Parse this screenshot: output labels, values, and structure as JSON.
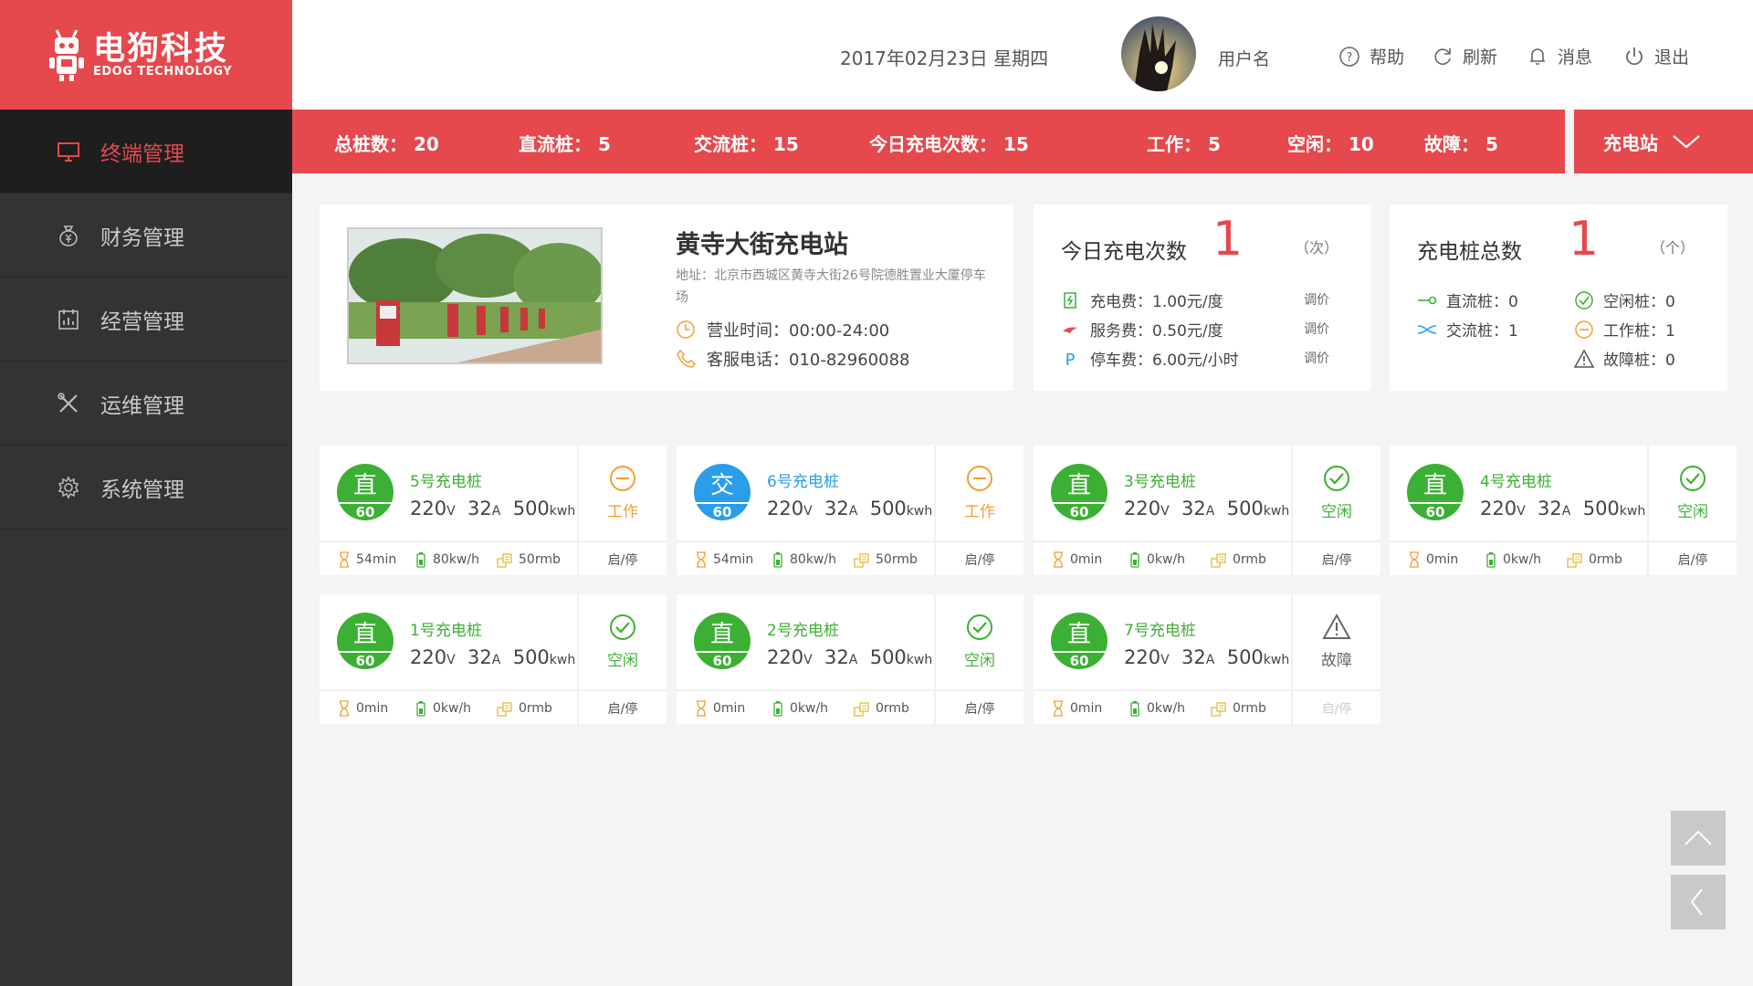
{
  "brand": {
    "name_cn": "电狗科技",
    "name_en": "EDOG TECHNOLOGY",
    "color": "#e5484d"
  },
  "sidebar": {
    "items": [
      {
        "label": "终端管理",
        "icon": "monitor-icon",
        "active": true
      },
      {
        "label": "财务管理",
        "icon": "money-bag-icon",
        "active": false
      },
      {
        "label": "经营管理",
        "icon": "calendar-chart-icon",
        "active": false
      },
      {
        "label": "运维管理",
        "icon": "tools-icon",
        "active": false
      },
      {
        "label": "系统管理",
        "icon": "gear-icon",
        "active": false
      }
    ]
  },
  "header": {
    "date": "2017年02月23日  星期四",
    "username": "用户名",
    "help": "帮助",
    "refresh": "刷新",
    "messages": "消息",
    "logout": "退出"
  },
  "stats": {
    "total_label": "总桩数：",
    "total": "20",
    "dc_label": "直流桩：",
    "dc": "5",
    "ac_label": "交流桩：",
    "ac": "15",
    "today_label": "今日充电次数：",
    "today": "15",
    "working_label": "工作：",
    "working": "5",
    "idle_label": "空闲：",
    "idle": "10",
    "fault_label": "故障：",
    "fault": "5",
    "station_select": "充电站"
  },
  "station": {
    "name": "黄寺大街充电站",
    "address": "地址：北京市西城区黄寺大街26号院德胜置业大厦停车场",
    "hours": "营业时间：00:00-24:00",
    "phone": "客服电话：010-82960088"
  },
  "today_panel": {
    "title": "今日充电次数",
    "value": "1",
    "unit": "（次）",
    "fees": [
      {
        "label": "充电费：1.00元/度",
        "adjust": "调价",
        "icon": "charger-icon"
      },
      {
        "label": "服务费：0.50元/度",
        "adjust": "调价",
        "icon": "service-icon"
      },
      {
        "label": "停车费：6.00元/小时",
        "adjust": "调价",
        "icon": "parking-icon"
      }
    ]
  },
  "pile_panel": {
    "title": "充电桩总数",
    "value": "1",
    "unit": "（个）",
    "dc": "直流桩：0",
    "ac": "交流桩：1",
    "idle": "空闲桩：0",
    "working": "工作桩：1",
    "fault": "故障桩：0"
  },
  "piles": [
    {
      "name": "5号充电桩",
      "type": "直",
      "power": "60",
      "voltage": "220",
      "current": "32",
      "energy": "500",
      "status": "工作",
      "status_kind": "working",
      "time": "54min",
      "rate": "80kw/h",
      "cost": "50rmb",
      "action": "启/停",
      "action_enabled": true
    },
    {
      "name": "6号充电桩",
      "type": "交",
      "power": "60",
      "voltage": "220",
      "current": "32",
      "energy": "500",
      "status": "工作",
      "status_kind": "working",
      "time": "54min",
      "rate": "80kw/h",
      "cost": "50rmb",
      "action": "启/停",
      "action_enabled": true
    },
    {
      "name": "3号充电桩",
      "type": "直",
      "power": "60",
      "voltage": "220",
      "current": "32",
      "energy": "500",
      "status": "空闲",
      "status_kind": "idle",
      "time": "0min",
      "rate": "0kw/h",
      "cost": "0rmb",
      "action": "启/停",
      "action_enabled": true
    },
    {
      "name": "4号充电桩",
      "type": "直",
      "power": "60",
      "voltage": "220",
      "current": "32",
      "energy": "500",
      "status": "空闲",
      "status_kind": "idle",
      "time": "0min",
      "rate": "0kw/h",
      "cost": "0rmb",
      "action": "启/停",
      "action_enabled": true
    },
    {
      "name": "1号充电桩",
      "type": "直",
      "power": "60",
      "voltage": "220",
      "current": "32",
      "energy": "500",
      "status": "空闲",
      "status_kind": "idle",
      "time": "0min",
      "rate": "0kw/h",
      "cost": "0rmb",
      "action": "启/停",
      "action_enabled": true
    },
    {
      "name": "2号充电桩",
      "type": "直",
      "power": "60",
      "voltage": "220",
      "current": "32",
      "energy": "500",
      "status": "空闲",
      "status_kind": "idle",
      "time": "0min",
      "rate": "0kw/h",
      "cost": "0rmb",
      "action": "启/停",
      "action_enabled": true
    },
    {
      "name": "7号充电桩",
      "type": "直",
      "power": "60",
      "voltage": "220",
      "current": "32",
      "energy": "500",
      "status": "故障",
      "status_kind": "fault",
      "time": "0min",
      "rate": "0kw/h",
      "cost": "0rmb",
      "action": "启/停",
      "action_enabled": false
    }
  ],
  "units": {
    "voltage": "V",
    "current": "A",
    "energy": "kwh"
  },
  "colors": {
    "dc": "#3cb034",
    "ac": "#2c9de8",
    "working": "#f0a030",
    "idle": "#3cb034",
    "fault": "#666666",
    "accent": "#e5484d"
  }
}
